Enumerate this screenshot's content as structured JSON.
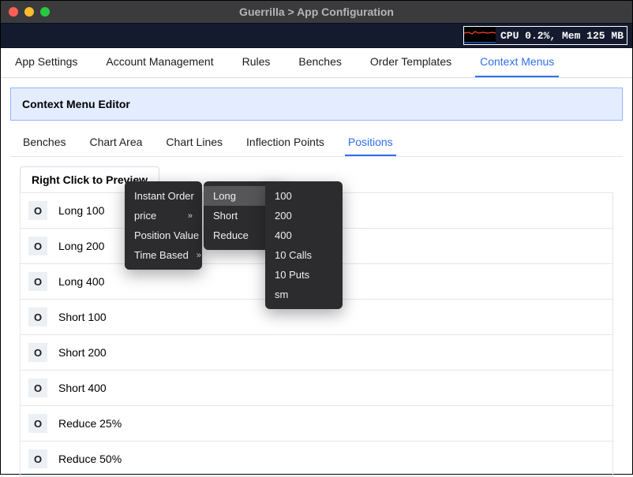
{
  "window": {
    "title": "Guerrilla > App Configuration"
  },
  "perf": {
    "text": "CPU 0.2%, Mem 125 MB"
  },
  "tabs": [
    {
      "label": "App Settings"
    },
    {
      "label": "Account Management"
    },
    {
      "label": "Rules"
    },
    {
      "label": "Benches"
    },
    {
      "label": "Order Templates"
    },
    {
      "label": "Context Menus",
      "active": true
    }
  ],
  "panel": {
    "title": "Context Menu Editor"
  },
  "subtabs": [
    {
      "label": "Benches"
    },
    {
      "label": "Chart Area"
    },
    {
      "label": "Chart Lines"
    },
    {
      "label": "Inflection Points"
    },
    {
      "label": "Positions",
      "active": true
    }
  ],
  "preview_label": "Right Click to Preview",
  "handle_glyph": "O",
  "rows": [
    {
      "label": "Long 100"
    },
    {
      "label": "Long 200"
    },
    {
      "label": "Long 400"
    },
    {
      "label": "Short 100"
    },
    {
      "label": "Short 200"
    },
    {
      "label": "Short 400"
    },
    {
      "label": "Reduce 25%"
    },
    {
      "label": "Reduce 50%"
    }
  ],
  "ctx": {
    "level1": [
      {
        "label": "Instant Order",
        "has_sub": true
      },
      {
        "label": "price",
        "has_sub": true
      },
      {
        "label": "Position Value",
        "has_sub": true
      },
      {
        "label": "Time Based",
        "has_sub": true
      }
    ],
    "level2": [
      {
        "label": "Long",
        "has_sub": true,
        "hovered": true
      },
      {
        "label": "Short",
        "has_sub": true
      },
      {
        "label": "Reduce",
        "has_sub": true
      }
    ],
    "level3": [
      {
        "label": "100"
      },
      {
        "label": "200"
      },
      {
        "label": "400"
      },
      {
        "label": "10 Calls"
      },
      {
        "label": "10 Puts"
      },
      {
        "label": "sm"
      }
    ]
  }
}
